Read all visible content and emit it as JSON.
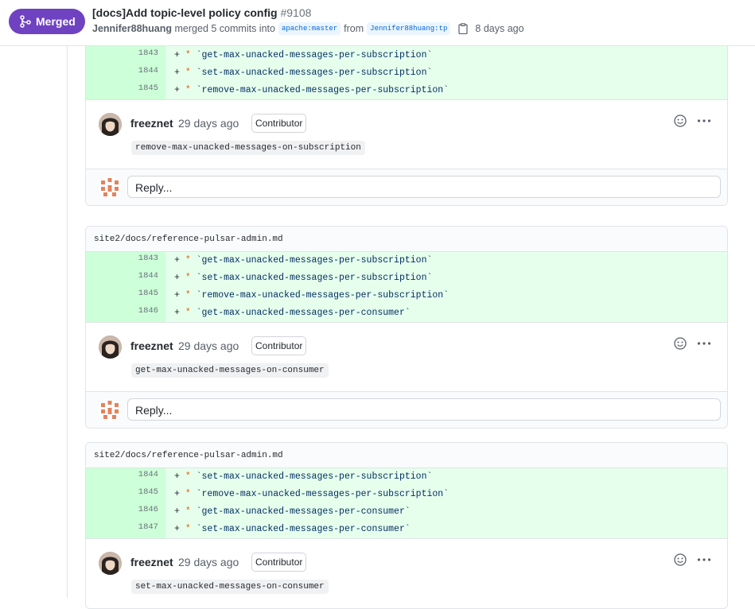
{
  "header": {
    "status_label": "Merged",
    "title": "[docs]Add topic-level policy config",
    "number": "#9108",
    "author": "Jennifer88huang",
    "merged_text": "merged 5 commits into",
    "base_branch": "apache:master",
    "from_text": "from",
    "head_branch": "Jennifer88huang:tp",
    "time_ago": "8 days ago"
  },
  "threads": [
    {
      "file": "",
      "lines": [
        {
          "num": "1843",
          "prefix": "+ ",
          "star": "*",
          "text": " `get-max-unacked-messages-per-subscription`"
        },
        {
          "num": "1844",
          "prefix": "+ ",
          "star": "*",
          "text": " `set-max-unacked-messages-per-subscription`"
        },
        {
          "num": "1845",
          "prefix": "+ ",
          "star": "*",
          "text": " `remove-max-unacked-messages-per-subscription`"
        }
      ],
      "comment": {
        "author": "freeznet",
        "time": "29 days ago",
        "badge": "Contributor",
        "body": "remove-max-unacked-messages-on-subscription"
      },
      "reply_placeholder": "Reply..."
    },
    {
      "file": "site2/docs/reference-pulsar-admin.md",
      "lines": [
        {
          "num": "1843",
          "prefix": "+ ",
          "star": "*",
          "text": " `get-max-unacked-messages-per-subscription`"
        },
        {
          "num": "1844",
          "prefix": "+ ",
          "star": "*",
          "text": " `set-max-unacked-messages-per-subscription`"
        },
        {
          "num": "1845",
          "prefix": "+ ",
          "star": "*",
          "text": " `remove-max-unacked-messages-per-subscription`"
        },
        {
          "num": "1846",
          "prefix": "+ ",
          "star": "*",
          "text": " `get-max-unacked-messages-per-consumer`"
        }
      ],
      "comment": {
        "author": "freeznet",
        "time": "29 days ago",
        "badge": "Contributor",
        "body": "get-max-unacked-messages-on-consumer"
      },
      "reply_placeholder": "Reply..."
    },
    {
      "file": "site2/docs/reference-pulsar-admin.md",
      "lines": [
        {
          "num": "1844",
          "prefix": "+ ",
          "star": "*",
          "text": " `set-max-unacked-messages-per-subscription`"
        },
        {
          "num": "1845",
          "prefix": "+ ",
          "star": "*",
          "text": " `remove-max-unacked-messages-per-subscription`"
        },
        {
          "num": "1846",
          "prefix": "+ ",
          "star": "*",
          "text": " `get-max-unacked-messages-per-consumer`"
        },
        {
          "num": "1847",
          "prefix": "+ ",
          "star": "*",
          "text": " `set-max-unacked-messages-per-consumer`"
        }
      ],
      "comment": {
        "author": "freeznet",
        "time": "29 days ago",
        "badge": "Contributor",
        "body": "set-max-unacked-messages-on-consumer"
      }
    }
  ],
  "icons": {
    "merge": "git-merge-icon",
    "clipboard": "clipboard-icon",
    "emoji": "smiley-icon",
    "more": "kebab-horizontal-icon"
  },
  "colors": {
    "merged": "#6f42c1",
    "addition_bg": "#e6ffed",
    "addition_num_bg": "#cdffd8",
    "link": "#0366d6"
  }
}
